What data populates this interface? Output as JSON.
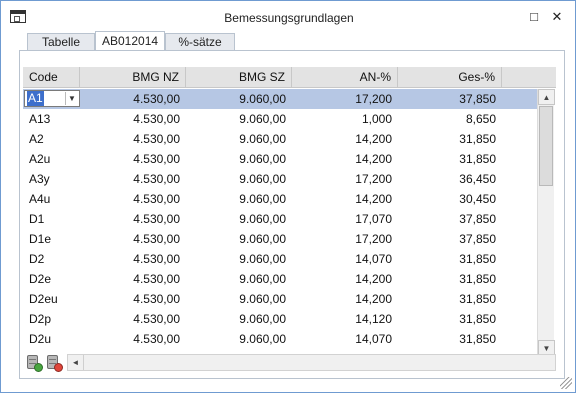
{
  "window": {
    "title": "Bemessungsgrundlagen",
    "minimize_glyph": "□",
    "close_glyph": "✕"
  },
  "tabs": [
    {
      "label": "Tabelle",
      "active": false
    },
    {
      "label": "AB012014",
      "active": true
    },
    {
      "label": "%-sätze",
      "active": false
    }
  ],
  "grid": {
    "columns": [
      "Code",
      "BMG NZ",
      "BMG SZ",
      "AN-%",
      "Ges-%"
    ],
    "editor": {
      "value": "A1",
      "dropdown_glyph": "▼"
    },
    "rows": [
      {
        "code": "A1",
        "bmg_nz": "4.530,00",
        "bmg_sz": "9.060,00",
        "an": "17,200",
        "ges": "37,850",
        "selected": true
      },
      {
        "code": "A13",
        "bmg_nz": "4.530,00",
        "bmg_sz": "9.060,00",
        "an": "1,000",
        "ges": "8,650"
      },
      {
        "code": "A2",
        "bmg_nz": "4.530,00",
        "bmg_sz": "9.060,00",
        "an": "14,200",
        "ges": "31,850"
      },
      {
        "code": "A2u",
        "bmg_nz": "4.530,00",
        "bmg_sz": "9.060,00",
        "an": "14,200",
        "ges": "31,850"
      },
      {
        "code": "A3y",
        "bmg_nz": "4.530,00",
        "bmg_sz": "9.060,00",
        "an": "17,200",
        "ges": "36,450"
      },
      {
        "code": "A4u",
        "bmg_nz": "4.530,00",
        "bmg_sz": "9.060,00",
        "an": "14,200",
        "ges": "30,450"
      },
      {
        "code": "D1",
        "bmg_nz": "4.530,00",
        "bmg_sz": "9.060,00",
        "an": "17,070",
        "ges": "37,850"
      },
      {
        "code": "D1e",
        "bmg_nz": "4.530,00",
        "bmg_sz": "9.060,00",
        "an": "17,200",
        "ges": "37,850"
      },
      {
        "code": "D2",
        "bmg_nz": "4.530,00",
        "bmg_sz": "9.060,00",
        "an": "14,070",
        "ges": "31,850"
      },
      {
        "code": "D2e",
        "bmg_nz": "4.530,00",
        "bmg_sz": "9.060,00",
        "an": "14,200",
        "ges": "31,850"
      },
      {
        "code": "D2eu",
        "bmg_nz": "4.530,00",
        "bmg_sz": "9.060,00",
        "an": "14,200",
        "ges": "31,850"
      },
      {
        "code": "D2p",
        "bmg_nz": "4.530,00",
        "bmg_sz": "9.060,00",
        "an": "14,120",
        "ges": "31,850"
      },
      {
        "code": "D2u",
        "bmg_nz": "4.530,00",
        "bmg_sz": "9.060,00",
        "an": "14,070",
        "ges": "31,850"
      }
    ]
  },
  "scrollbar": {
    "up_glyph": "▲",
    "down_glyph": "▼",
    "left_glyph": "◄",
    "right_glyph": "►"
  },
  "colors": {
    "selected_row": "#b6c7e4",
    "header_bg": "#e3e3e3",
    "window_border": "#6f9bd1"
  }
}
